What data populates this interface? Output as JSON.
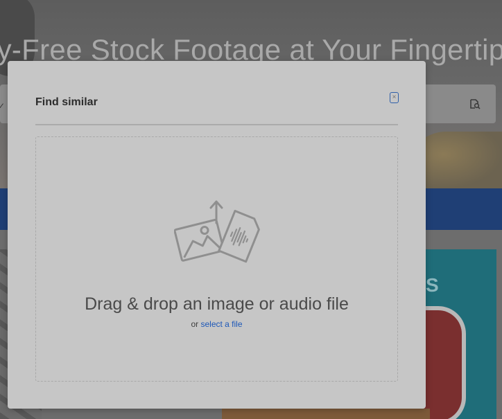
{
  "background": {
    "hero_title": "lty-Free Stock Footage at Your Fingertips",
    "search_chevron": "✓",
    "visual_search_icon": "camera-search-icon",
    "promo_letter": "S"
  },
  "modal": {
    "title": "Find similar",
    "close_label": "×",
    "close_icon": "close-icon",
    "dropzone": {
      "icon": "image-audio-upload-icon",
      "headline": "Drag & drop an image or audio file",
      "or_text": "or",
      "select_link": "select a file"
    }
  },
  "colors": {
    "overlay": "#6b6b6b",
    "modal_bg": "#c6c6c6",
    "link": "#1c57b8",
    "focus_ring": "#2e5ea8",
    "icon_gray": "#8f8f8f"
  }
}
